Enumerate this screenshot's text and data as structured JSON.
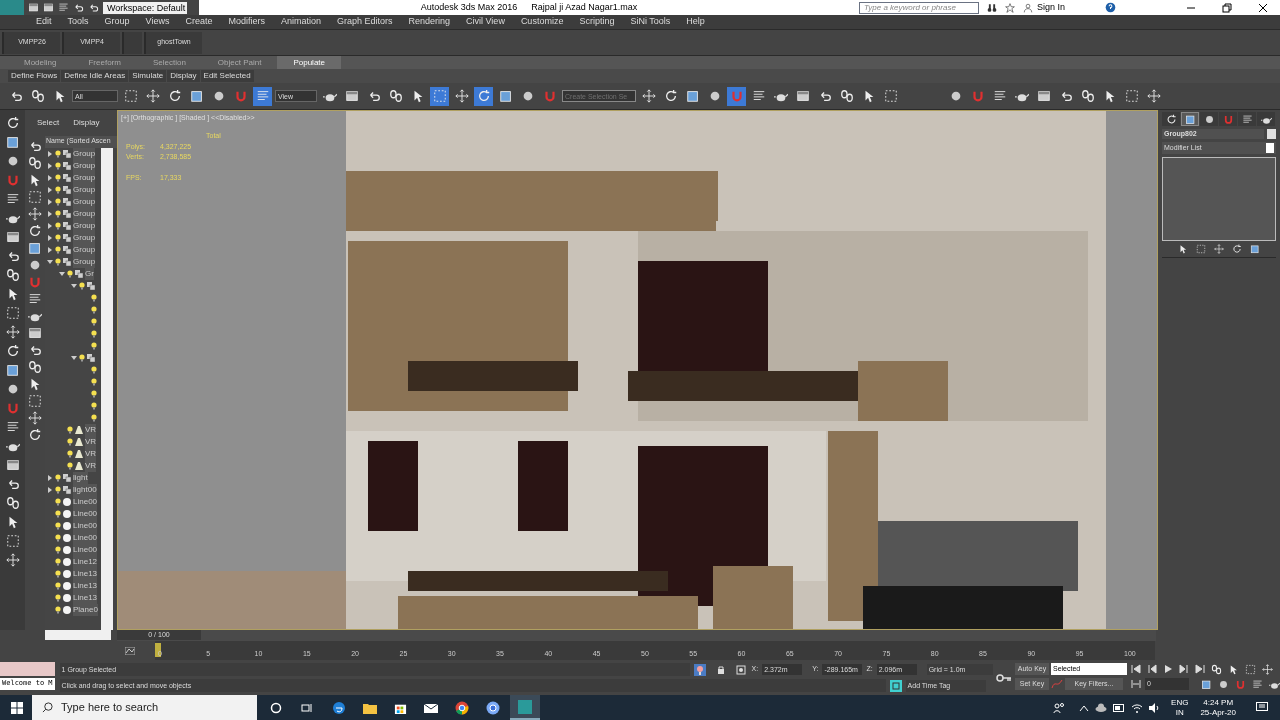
{
  "title_bar": {
    "workspace": "Workspace: Default",
    "app_title": "Autodesk 3ds Max 2016",
    "file_name": "Rajpal ji Azad Nagar1.max",
    "search": {
      "placeholder": "Type a keyword or phrase"
    },
    "sign_in": "Sign In"
  },
  "menu": [
    "Edit",
    "Tools",
    "Group",
    "Views",
    "Create",
    "Modifiers",
    "Animation",
    "Graph Editors",
    "Rendering",
    "Civil View",
    "Customize",
    "Scripting",
    "SiNi Tools",
    "Help"
  ],
  "custom_toolbar": [
    "VMPP26",
    "VMPP4",
    "ghostTown"
  ],
  "ribbon_tabs": [
    {
      "label": "Modeling",
      "selected": false
    },
    {
      "label": "Freeform",
      "selected": false
    },
    {
      "label": "Selection",
      "selected": false
    },
    {
      "label": "Object Paint",
      "selected": false
    },
    {
      "label": "Populate",
      "selected": true
    }
  ],
  "ribbon_buttons": [
    "Define Flows",
    "Define Idle Areas",
    "Simulate",
    "Display",
    "Edit Selected"
  ],
  "main_toolbar": {
    "selection_filter": "All",
    "reference_coordinate": "View",
    "named_selection": {
      "placeholder": "Create Selection Se"
    },
    "left_buttons": [
      {
        "active": false
      },
      {
        "active": false
      },
      {
        "active": false
      },
      {
        "active": false
      },
      {
        "active": false
      },
      {
        "active": false
      },
      {
        "active": false
      },
      {
        "active": false
      },
      {
        "active": false
      },
      {
        "active": true
      },
      {
        "active": false
      },
      {
        "active": false
      },
      {
        "active": false
      },
      {
        "active": false
      },
      {
        "active": false
      },
      {
        "active": true
      },
      {
        "active": false
      },
      {
        "active": true
      },
      {
        "active": false
      },
      {
        "active": false
      },
      {
        "active": false
      }
    ],
    "right_buttons": [
      {
        "active": false
      },
      {
        "active": false
      },
      {
        "active": false
      },
      {
        "active": false
      },
      {
        "active": true
      },
      {
        "active": false
      },
      {
        "active": false
      },
      {
        "active": false
      },
      {
        "active": false
      },
      {
        "active": false
      },
      {
        "active": false
      },
      {
        "active": false
      }
    ],
    "plugin_buttons": [
      {
        "active": false
      },
      {
        "active": false
      },
      {
        "active": false
      },
      {
        "active": false
      },
      {
        "active": false
      },
      {
        "active": false
      },
      {
        "active": false
      },
      {
        "active": false
      },
      {
        "active": false
      },
      {
        "active": false
      }
    ]
  },
  "scene_explorer": {
    "tabs": [
      "Select",
      "Display"
    ],
    "column_header": "Name (Sorted Ascen",
    "tree": [
      {
        "label": "Group",
        "kind": "group",
        "expanded": false
      },
      {
        "label": "Group",
        "kind": "group",
        "expanded": false
      },
      {
        "label": "Group",
        "kind": "group",
        "expanded": false
      },
      {
        "label": "Group",
        "kind": "group",
        "expanded": false
      },
      {
        "label": "Group",
        "kind": "group",
        "expanded": false
      },
      {
        "label": "Group",
        "kind": "group",
        "expanded": false
      },
      {
        "label": "Group",
        "kind": "group",
        "expanded": false
      },
      {
        "label": "Group",
        "kind": "group",
        "expanded": false
      },
      {
        "label": "Group",
        "kind": "group",
        "expanded": false
      },
      {
        "label": "Group",
        "kind": "group",
        "expanded": true,
        "children": [
          {
            "label": "Gr",
            "kind": "group",
            "expanded": true,
            "children": [
              {
                "kind": "group",
                "expanded": true,
                "children": [
                  {
                    "visible": true
                  },
                  {
                    "visible": true
                  },
                  {
                    "visible": true
                  },
                  {
                    "visible": true
                  },
                  {
                    "visible": true
                  }
                ]
              },
              {
                "kind": "group",
                "expanded": true,
                "children": [
                  {
                    "visible": true
                  },
                  {
                    "visible": true
                  },
                  {
                    "visible": true
                  },
                  {
                    "visible": true
                  },
                  {
                    "visible": true
                  }
                ]
              }
            ]
          },
          {
            "label": "VR",
            "kind": "light"
          },
          {
            "label": "VR",
            "kind": "light"
          },
          {
            "label": "VR",
            "kind": "light"
          },
          {
            "label": "VR",
            "kind": "light"
          }
        ]
      },
      {
        "label": "light",
        "kind": "group",
        "expanded": false
      },
      {
        "label": "light00",
        "kind": "group",
        "expanded": false
      },
      {
        "label": "Line00",
        "kind": "shape"
      },
      {
        "label": "Line00",
        "kind": "shape"
      },
      {
        "label": "Line00",
        "kind": "shape"
      },
      {
        "label": "Line00",
        "kind": "shape"
      },
      {
        "label": "Line00",
        "kind": "shape"
      },
      {
        "label": "Line12",
        "kind": "shape"
      },
      {
        "label": "Line13",
        "kind": "shape"
      },
      {
        "label": "Line13",
        "kind": "shape"
      },
      {
        "label": "Line13",
        "kind": "shape"
      },
      {
        "label": "Plane0",
        "kind": "shape"
      }
    ]
  },
  "viewport": {
    "label": "[+] [Orthographic ] [Shaded ] <<Disabled>>",
    "stats_header": "Total",
    "stats": [
      {
        "label": "Polys:",
        "value": "4,327,225"
      },
      {
        "label": "Verts:",
        "value": "2,738,585"
      }
    ],
    "fps": {
      "label": "FPS:",
      "value": "17,333"
    }
  },
  "command_panel": {
    "tabs": [
      {
        "selected": false
      },
      {
        "selected": true
      },
      {
        "selected": false
      },
      {
        "selected": false
      },
      {
        "selected": false
      },
      {
        "selected": false
      }
    ],
    "object_name": "Group802",
    "modifier_list": "Modifier List"
  },
  "timeline": {
    "time_slider": "0 / 100",
    "ruler_labels": [
      "0",
      "5",
      "10",
      "15",
      "20",
      "25",
      "30",
      "35",
      "40",
      "45",
      "50",
      "55",
      "60",
      "65",
      "70",
      "75",
      "80",
      "85",
      "90",
      "95",
      "100"
    ]
  },
  "status_bar": {
    "listener": "Welcome to M",
    "x_label": "X:",
    "y_label": "Y:",
    "z_label": "Z:",
    "selection": "1 Group Selected",
    "prompt": "Click and drag to select and move objects",
    "x": "2.372m",
    "y": "-289.165m",
    "z": "2.096m",
    "grid": "Grid = 1.0m",
    "add_time_tag": "Add Time Tag",
    "auto_key": "Auto Key",
    "key_mode": "Selected",
    "set_key": "Set Key",
    "key_filters": "Key Filters...",
    "frame": "0"
  },
  "taskbar": {
    "search": {
      "placeholder": "Type here to search"
    },
    "language": "ENG",
    "region": "IN",
    "time": "4:24 PM",
    "date": "25-Apr-20"
  }
}
